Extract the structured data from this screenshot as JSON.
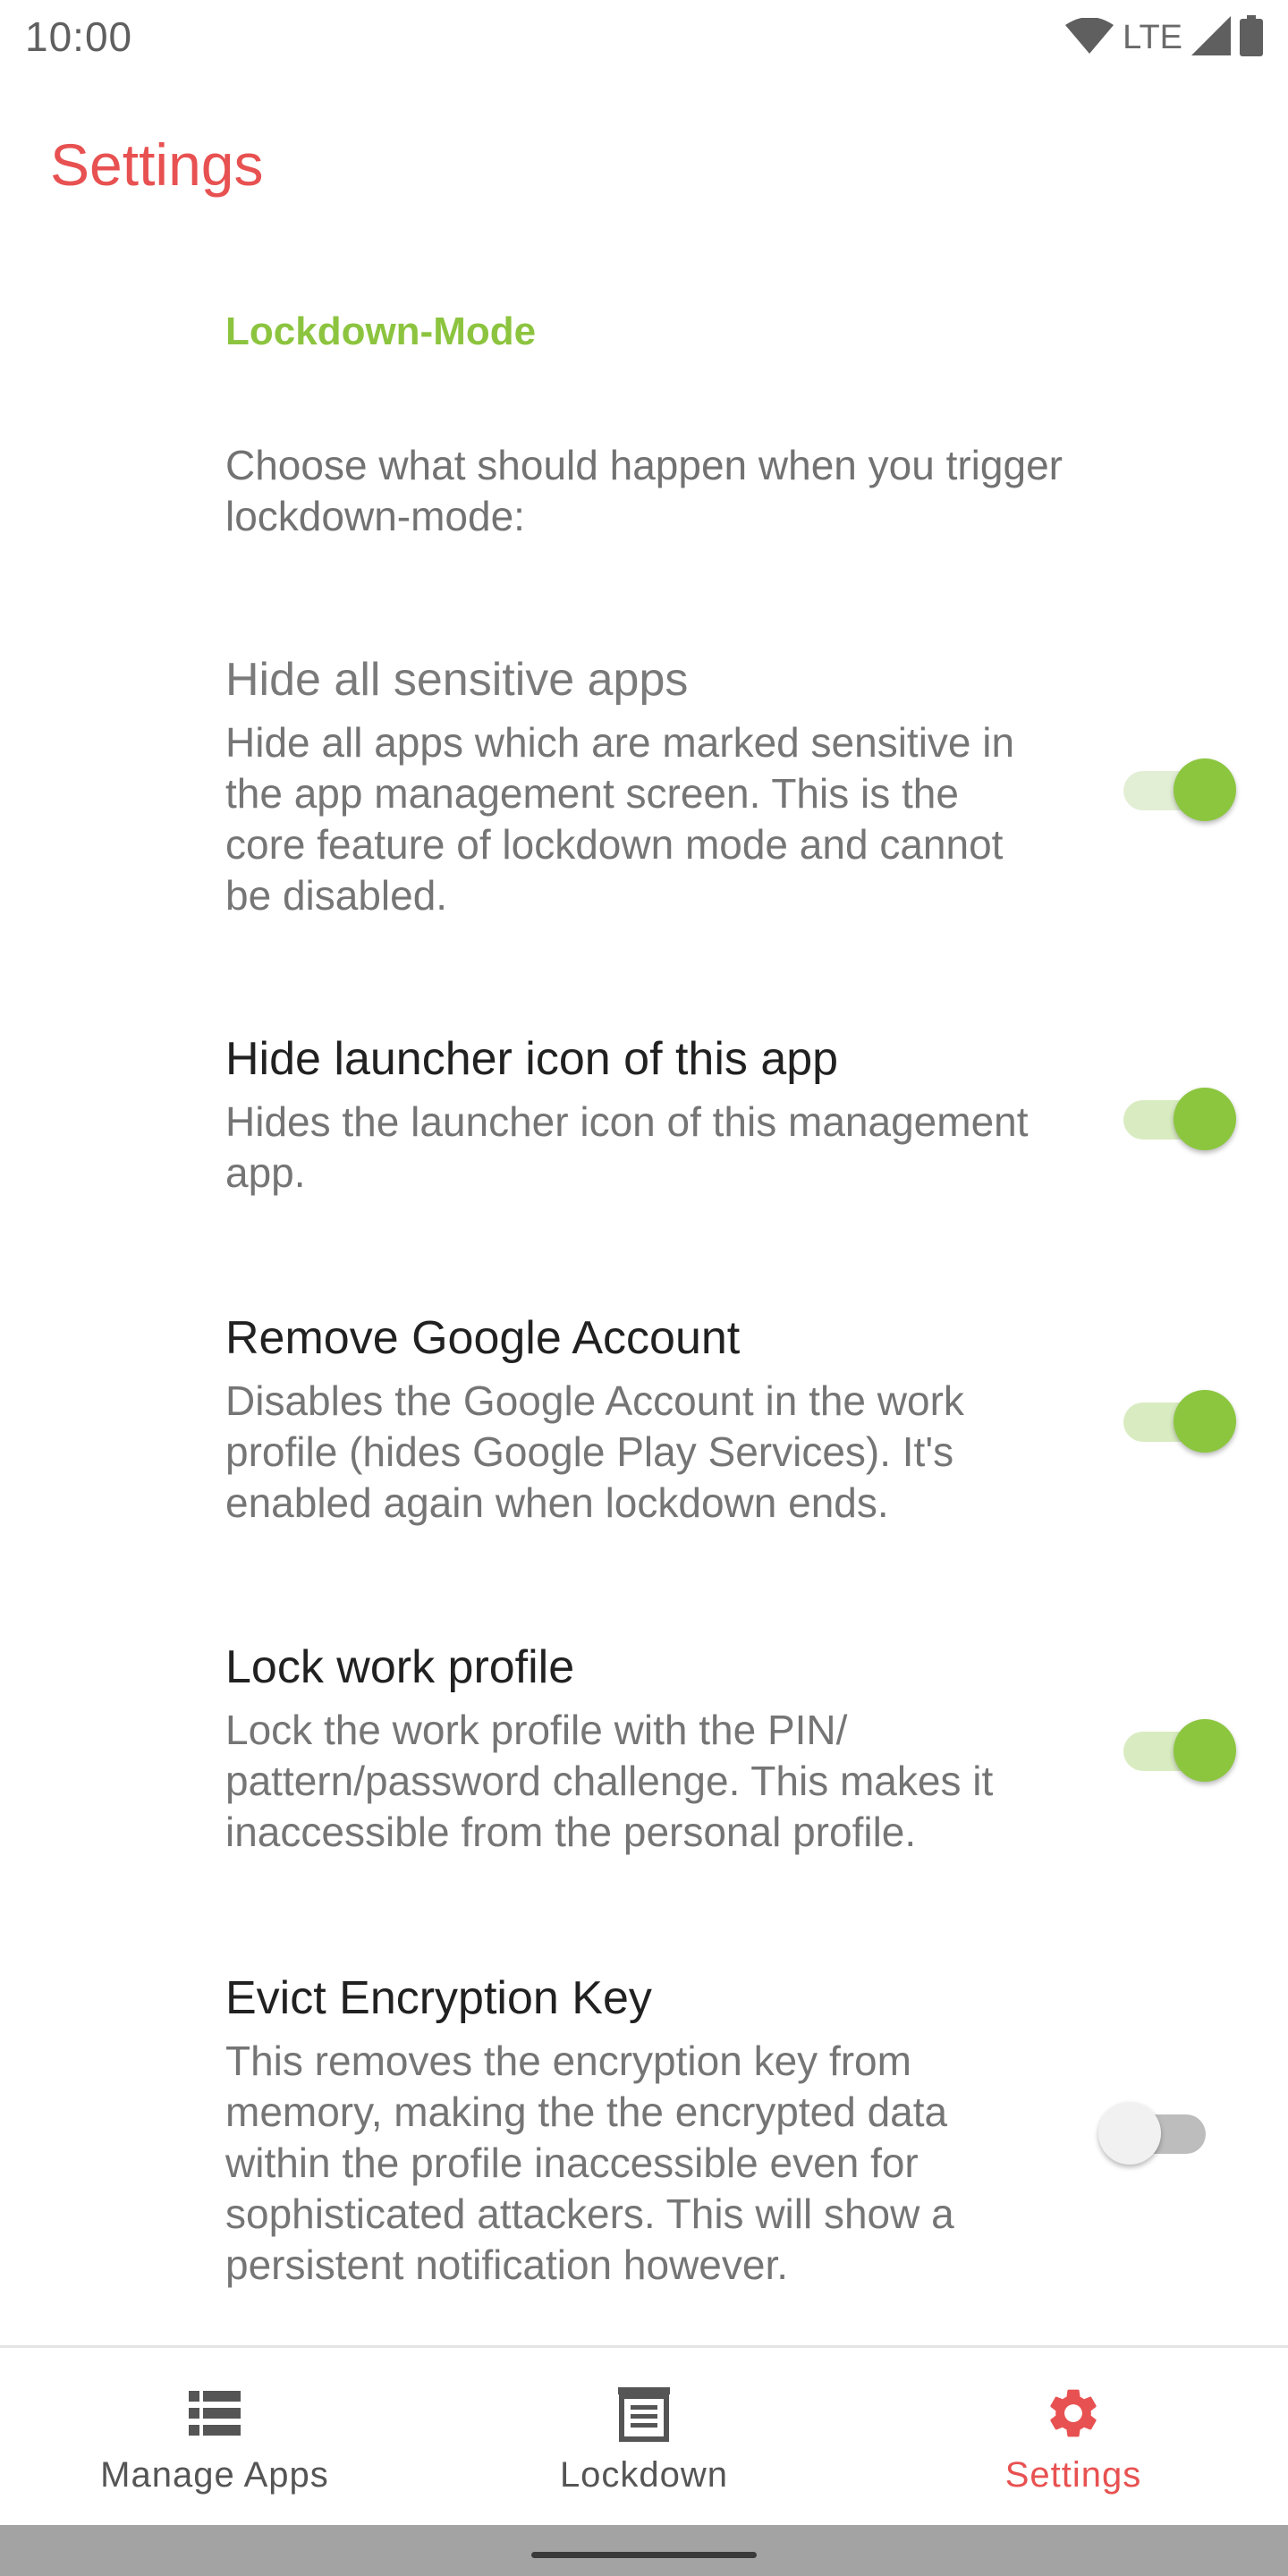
{
  "status_bar": {
    "time": "10:00",
    "network": "LTE",
    "icons": [
      "wifi-icon",
      "cell-signal-icon",
      "battery-icon"
    ]
  },
  "app_bar": {
    "title": "Settings"
  },
  "preferences": {
    "category": "Lockdown-Mode",
    "intro": "Choose what should happen when you trigger lockdown-mode:",
    "items": [
      {
        "title": "Hide all sensitive apps",
        "summary": "Hide all apps which are marked sensitive in the app management screen. This is the core feature of lockdown mode and cannot be disabled.",
        "checked": true,
        "enabled": false
      },
      {
        "title": "Hide launcher icon of this app",
        "summary": "Hides the launcher icon of this management app.",
        "checked": true,
        "enabled": true
      },
      {
        "title": "Remove Google Account",
        "summary": "Disables the Google Account in the work profile (hides Google Play Services). It's enabled again when lockdown ends.",
        "checked": true,
        "enabled": true
      },
      {
        "title": "Lock work profile",
        "summary": "Lock the work profile with the PIN/ pattern/password challenge. This makes it inaccessible from the personal profile.",
        "checked": true,
        "enabled": true
      },
      {
        "title": "Evict Encryption Key",
        "summary": "This removes the encryption key from memory, making the the encrypted data within the profile inaccessible even for sophisticated attackers. This will show a persistent notification however.",
        "checked": false,
        "enabled": true
      }
    ]
  },
  "bottom_nav": {
    "items": [
      {
        "label": "Manage Apps",
        "icon": "list-icon",
        "active": false
      },
      {
        "label": "Lockdown",
        "icon": "lockdown-icon",
        "active": false
      },
      {
        "label": "Settings",
        "icon": "gear-icon",
        "active": true
      }
    ]
  },
  "colors": {
    "accent": "#e85151",
    "switch_on": "#8cc63f",
    "category": "#8cc43f",
    "nav_inactive": "#555555"
  }
}
